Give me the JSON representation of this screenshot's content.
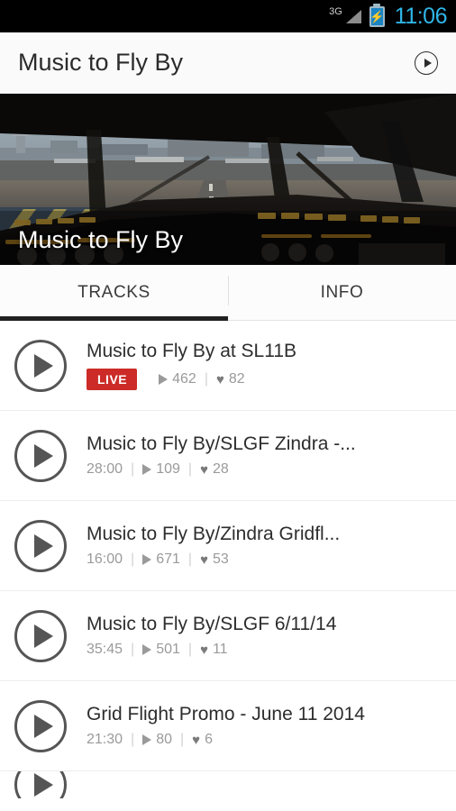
{
  "status_bar": {
    "network": "3G",
    "signal_icon": "signal-triangle-icon",
    "battery_icon": "battery-charging-icon",
    "battery_bolt": "⚡",
    "time": "11:06",
    "clock_color": "#2fb6e8"
  },
  "app_bar": {
    "title": "Music to Fly By",
    "play_icon": "circle-play-icon"
  },
  "hero": {
    "title": "Music to Fly By",
    "image_alt": "airplane-cockpit-view"
  },
  "tabs": [
    {
      "label": "TRACKS",
      "active": true
    },
    {
      "label": "INFO",
      "active": false
    }
  ],
  "icons": {
    "play": "play-icon",
    "heart": "♥",
    "play_count": "play-count-icon",
    "like_count": "heart-icon"
  },
  "colors": {
    "live_badge": "#cc2b27",
    "tab_indicator": "#212121",
    "meta_text": "#9a9a9a"
  },
  "tracks": [
    {
      "title": "Music to Fly By at SL11B",
      "live": true,
      "live_label": "LIVE",
      "duration": "",
      "plays": "462",
      "likes": "82"
    },
    {
      "title": "Music to Fly By/SLGF Zindra -...",
      "live": false,
      "live_label": "",
      "duration": "28:00",
      "plays": "109",
      "likes": "28"
    },
    {
      "title": "Music to Fly By/Zindra Gridfl...",
      "live": false,
      "live_label": "",
      "duration": "16:00",
      "plays": "671",
      "likes": "53"
    },
    {
      "title": "Music to Fly By/SLGF 6/11/14",
      "live": false,
      "live_label": "",
      "duration": "35:45",
      "plays": "501",
      "likes": "11"
    },
    {
      "title": "Grid Flight Promo - June 11 2014",
      "live": false,
      "live_label": "",
      "duration": "21:30",
      "plays": "80",
      "likes": "6"
    }
  ]
}
